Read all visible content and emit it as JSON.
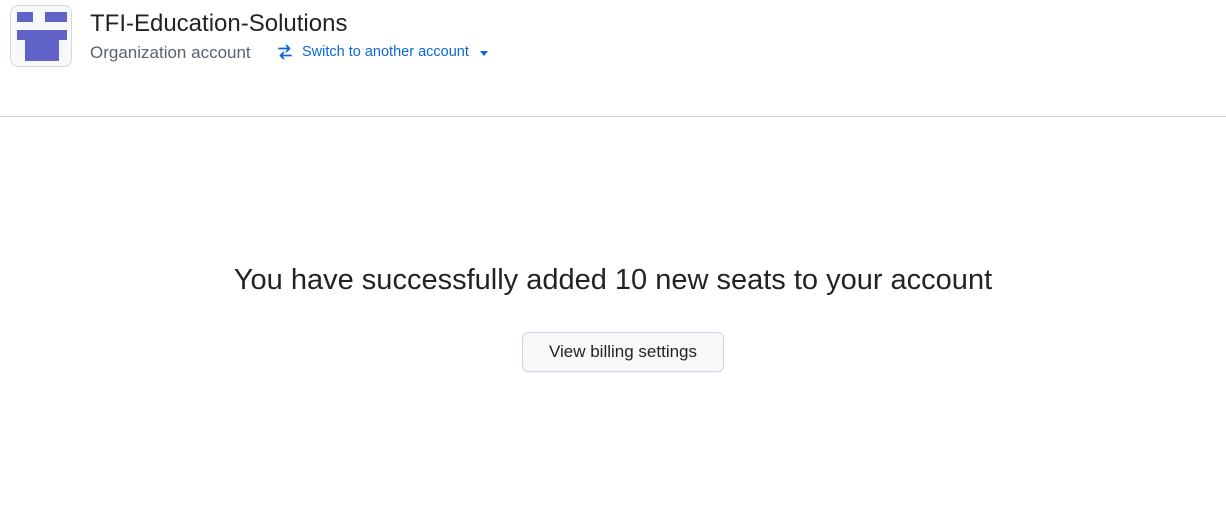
{
  "organization": {
    "name": "TFI-Education-Solutions",
    "account_type": "Organization account",
    "avatar_icon": "organization-logo-icon",
    "avatar_color": "#6163c8"
  },
  "account_switcher": {
    "label": "Switch to another account",
    "icon": "arrow-switch-icon",
    "caret_icon": "triangle-down-icon",
    "color": "#0969da"
  },
  "confirmation": {
    "message": "You have successfully added 10 new seats to your account",
    "button_label": "View billing settings"
  },
  "colors": {
    "text": "#1f2328",
    "muted_text": "#59636e",
    "border": "#d0d7de",
    "button_background": "#f6f8fa"
  }
}
